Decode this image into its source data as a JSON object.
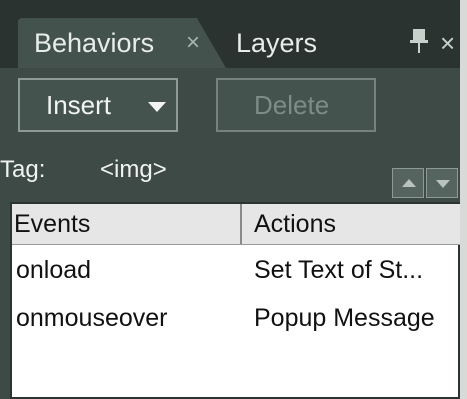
{
  "tabs": {
    "behaviors": {
      "label": "Behaviors",
      "close": "×"
    },
    "layers": {
      "label": "Layers"
    },
    "panel_close": "×"
  },
  "toolbar": {
    "insert_label": "Insert",
    "delete_label": "Delete"
  },
  "tag": {
    "label": "Tag:",
    "value": "<img>"
  },
  "table": {
    "headers": {
      "events": "Events",
      "actions": "Actions"
    },
    "rows": [
      {
        "event": "onload",
        "action": "Set Text of St..."
      },
      {
        "event": "onmouseover",
        "action": "Popup Message"
      }
    ]
  }
}
